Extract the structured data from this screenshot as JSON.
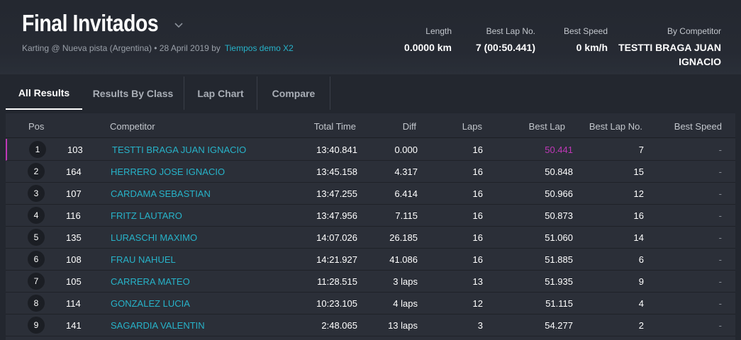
{
  "header": {
    "title": "Final Invitados",
    "subtitle": "Karting @ Nueva pista (Argentina) • 28 April 2019 by",
    "author_link": "Tiempos demo X2",
    "stats": [
      {
        "label": "Length",
        "value": "0.0000 km"
      },
      {
        "label": "Best Lap No.",
        "value": "7 (00:50.441)"
      },
      {
        "label": "Best Speed",
        "value": "0 km/h"
      },
      {
        "label": "By Competitor",
        "value_line1": "TESTTI BRAGA JUAN",
        "value_line2": "IGNACIO"
      }
    ]
  },
  "tabs": [
    "All Results",
    "Results By Class",
    "Lap Chart",
    "Compare"
  ],
  "columns": [
    "Pos",
    "Competitor",
    "Total Time",
    "Diff",
    "Laps",
    "Best Lap",
    "Best Lap No.",
    "Best Speed"
  ],
  "rows": [
    {
      "pos": "1",
      "num": "103",
      "name": "TESTTI BRAGA JUAN IGNACIO",
      "total": "13:40.841",
      "diff": "0.000",
      "laps": "16",
      "best": "50.441",
      "bestno": "7",
      "speed": "-"
    },
    {
      "pos": "2",
      "num": "164",
      "name": "HERRERO JOSE IGNACIO",
      "total": "13:45.158",
      "diff": "4.317",
      "laps": "16",
      "best": "50.848",
      "bestno": "15",
      "speed": "-"
    },
    {
      "pos": "3",
      "num": "107",
      "name": "CARDAMA SEBASTIAN",
      "total": "13:47.255",
      "diff": "6.414",
      "laps": "16",
      "best": "50.966",
      "bestno": "12",
      "speed": "-"
    },
    {
      "pos": "4",
      "num": "116",
      "name": "FRITZ LAUTARO",
      "total": "13:47.956",
      "diff": "7.115",
      "laps": "16",
      "best": "50.873",
      "bestno": "16",
      "speed": "-"
    },
    {
      "pos": "5",
      "num": "135",
      "name": "LURASCHI MAXIMO",
      "total": "14:07.026",
      "diff": "26.185",
      "laps": "16",
      "best": "51.060",
      "bestno": "14",
      "speed": "-"
    },
    {
      "pos": "6",
      "num": "108",
      "name": "FRAU NAHUEL",
      "total": "14:21.927",
      "diff": "41.086",
      "laps": "16",
      "best": "51.885",
      "bestno": "6",
      "speed": "-"
    },
    {
      "pos": "7",
      "num": "105",
      "name": "CARRERA MATEO",
      "total": "11:28.515",
      "diff": "3 laps",
      "laps": "13",
      "best": "51.935",
      "bestno": "9",
      "speed": "-"
    },
    {
      "pos": "8",
      "num": "114",
      "name": "GONZALEZ LUCIA",
      "total": "10:23.105",
      "diff": "4 laps",
      "laps": "12",
      "best": "51.115",
      "bestno": "4",
      "speed": "-"
    },
    {
      "pos": "9",
      "num": "141",
      "name": "SAGARDIA VALENTIN",
      "total": "2:48.065",
      "diff": "13 laps",
      "laps": "3",
      "best": "54.277",
      "bestno": "2",
      "speed": "-"
    }
  ],
  "colors": {
    "accent": "#27b3c9",
    "best": "#c038b8",
    "background": "#23272f"
  }
}
